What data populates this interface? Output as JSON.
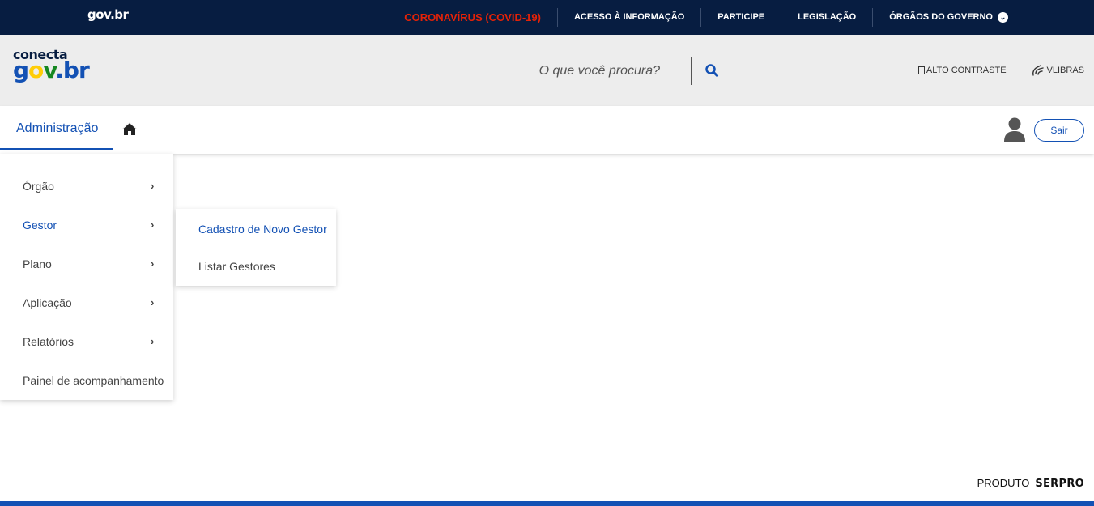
{
  "govbar": {
    "logo": "gov.br",
    "links": [
      {
        "label": "CORONAVÍRUS (COVID-19)"
      },
      {
        "label": "ACESSO À INFORMAÇÃO"
      },
      {
        "label": "PARTICIPE"
      },
      {
        "label": "LEGISLAÇÃO"
      },
      {
        "label": "ÓRGÃOS DO GOVERNO"
      }
    ]
  },
  "header": {
    "brand_top": "conecta",
    "brand_letters": [
      "g",
      "o",
      "v",
      ".",
      "br"
    ],
    "search_placeholder": "O que você procura?",
    "alto_contraste": "ALTO CONTRASTE",
    "vlibras": "VLIBRAS"
  },
  "nav": {
    "admin_label": "Administração",
    "logout_label": "Sair"
  },
  "menu": {
    "items": [
      {
        "label": "Órgão",
        "arrow": "›"
      },
      {
        "label": "Gestor",
        "arrow": "›"
      },
      {
        "label": "Plano",
        "arrow": "›"
      },
      {
        "label": "Aplicação",
        "arrow": "›"
      },
      {
        "label": "Relatórios",
        "arrow": "›"
      },
      {
        "label": "Painel de acompanhamento"
      }
    ],
    "submenu": [
      {
        "label": "Cadastro de Novo Gestor"
      },
      {
        "label": "Listar Gestores"
      }
    ]
  },
  "footer": {
    "produto": "PRODUTO",
    "brand": "SERPRO"
  },
  "colors": {
    "govbar_bg": "#071d41",
    "accent": "#1351b4",
    "covid": "#e52207",
    "header_bg": "#ededed"
  }
}
